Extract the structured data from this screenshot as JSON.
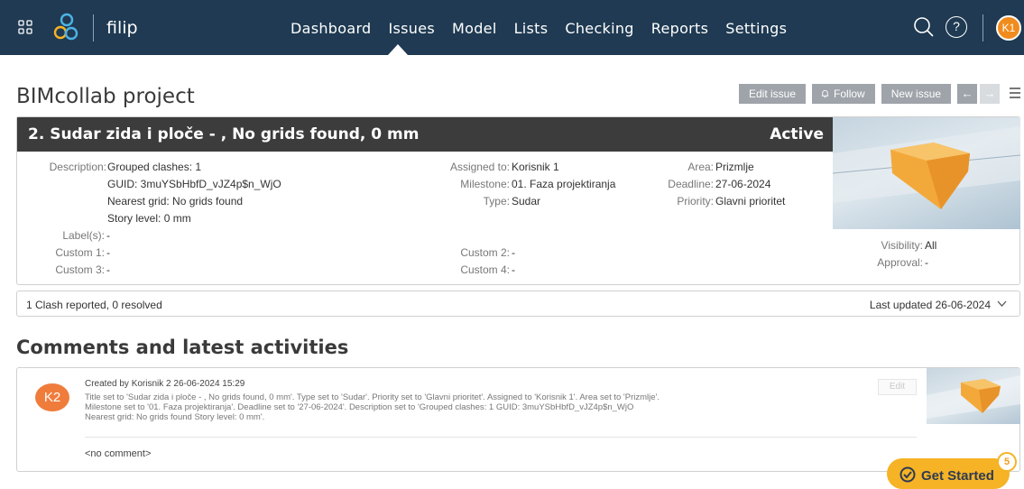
{
  "topbar": {
    "project_name": "filip",
    "nav": [
      "Dashboard",
      "Issues",
      "Model",
      "Lists",
      "Checking",
      "Reports",
      "Settings"
    ],
    "active_nav": "Issues",
    "help_glyph": "?",
    "user_initials": "K1",
    "brand_color": "#1f3a52",
    "accent_color": "#f08c1e"
  },
  "page": {
    "title": "BIMcollab project",
    "actions": {
      "edit_issue": "Edit issue",
      "follow": "Follow",
      "new_issue": "New issue",
      "menu_icon": "hamburger-icon"
    }
  },
  "issue": {
    "title": "2.  Sudar zida i ploče - , No grids found, 0 mm",
    "status": "Active",
    "description_label": "Description:",
    "description_lines": [
      "Grouped clashes: 1",
      "GUID: 3muYSbHbfD_vJZ4p$n_WjO",
      "Nearest grid: No grids found",
      "Story level: 0 mm"
    ],
    "labels_label": "Label(s):",
    "labels_value": "-",
    "custom1_label": "Custom 1:",
    "custom1_value": "-",
    "custom3_label": "Custom 3:",
    "custom3_value": "-",
    "assigned_label": "Assigned to:",
    "assigned_value": "Korisnik 1",
    "milestone_label": "Milestone:",
    "milestone_value": "01. Faza projektiranja",
    "type_label": "Type:",
    "type_value": "Sudar",
    "custom2_label": "Custom 2:",
    "custom2_value": "-",
    "custom4_label": "Custom 4:",
    "custom4_value": "-",
    "area_label": "Area:",
    "area_value": "Prizmlje",
    "deadline_label": "Deadline:",
    "deadline_value": "27-06-2024",
    "priority_label": "Priority:",
    "priority_value": "Glavni prioritet",
    "visibility_label": "Visibility:",
    "visibility_value": "All",
    "approval_label": "Approval:",
    "approval_value": "-"
  },
  "summary": {
    "clashes": "1 Clash reported, 0 resolved",
    "last_updated": "Last updated 26-06-2024"
  },
  "comments": {
    "title": "Comments and latest activities",
    "items": [
      {
        "avatar": "K2",
        "meta": "Created by Korisnik 2 26-06-2024 15:29",
        "text": "Title set to 'Sudar zida i ploče - , No grids found, 0 mm'. Type set to 'Sudar'. Priority set to 'Glavni prioritet'. Assigned to 'Korisnik 1'. Area set to 'Prizmlje'. Milestone set to '01. Faza projektiranja'. Deadline set to '27-06-2024'. Description set to 'Grouped clashes: 1 GUID: 3muYSbHbfD_vJZ4p$n_WjO Nearest grid: No grids found Story level: 0 mm'.",
        "comment": "<no comment>",
        "edit_label": "Edit"
      }
    ]
  },
  "get_started": {
    "label": "Get Started",
    "badge": "5"
  }
}
